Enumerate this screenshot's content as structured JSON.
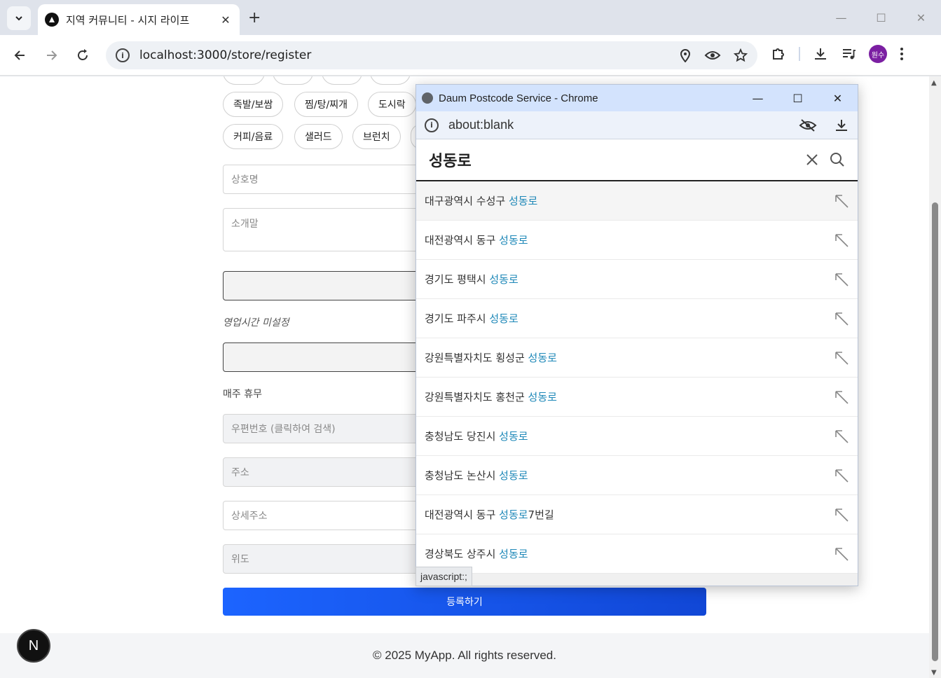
{
  "browser": {
    "tab_title": "지역 커뮤니티 - 시지 라이프",
    "url": "localhost:3000/store/register",
    "profile_initials": "원수"
  },
  "page": {
    "chips_row1": [
      "족발/보쌈",
      "찜/탕/찌개",
      "도시락"
    ],
    "chips_row2": [
      "커피/음료",
      "샐러드",
      "브런치"
    ],
    "store_name_placeholder": "상호명",
    "intro_placeholder": "소개말",
    "hours_label": "영업시간 미설정",
    "weekly_off_label": "매주 휴무",
    "postcode_placeholder": "우편번호 (클릭하여 검색)",
    "address_placeholder": "주소",
    "detail_address_placeholder": "상세주소",
    "latitude_placeholder": "위도",
    "submit_label": "등록하기",
    "footer": "© 2025 MyApp. All rights reserved.",
    "next_badge": "N"
  },
  "popup": {
    "title": "Daum Postcode Service - Chrome",
    "url": "about:blank",
    "search_value": "성동로",
    "results": [
      {
        "prefix": "대구광역시 수성구 ",
        "keyword": "성동로",
        "suffix": ""
      },
      {
        "prefix": "대전광역시 동구 ",
        "keyword": "성동로",
        "suffix": ""
      },
      {
        "prefix": "경기도 평택시 ",
        "keyword": "성동로",
        "suffix": ""
      },
      {
        "prefix": "경기도 파주시 ",
        "keyword": "성동로",
        "suffix": ""
      },
      {
        "prefix": "강원특별자치도 횡성군 ",
        "keyword": "성동로",
        "suffix": ""
      },
      {
        "prefix": "강원특별자치도 홍천군 ",
        "keyword": "성동로",
        "suffix": ""
      },
      {
        "prefix": "충청남도 당진시 ",
        "keyword": "성동로",
        "suffix": ""
      },
      {
        "prefix": "충청남도 논산시 ",
        "keyword": "성동로",
        "suffix": ""
      },
      {
        "prefix": "대전광역시 동구 ",
        "keyword": "성동로",
        "suffix": "7번길"
      },
      {
        "prefix": "경상북도 상주시 ",
        "keyword": "성동로",
        "suffix": ""
      }
    ],
    "status_tip": "javascript:;"
  },
  "colors": {
    "accent": "#1c64ff",
    "keyword": "#1e88b8",
    "popup_title_bg": "#d3e3fd"
  }
}
